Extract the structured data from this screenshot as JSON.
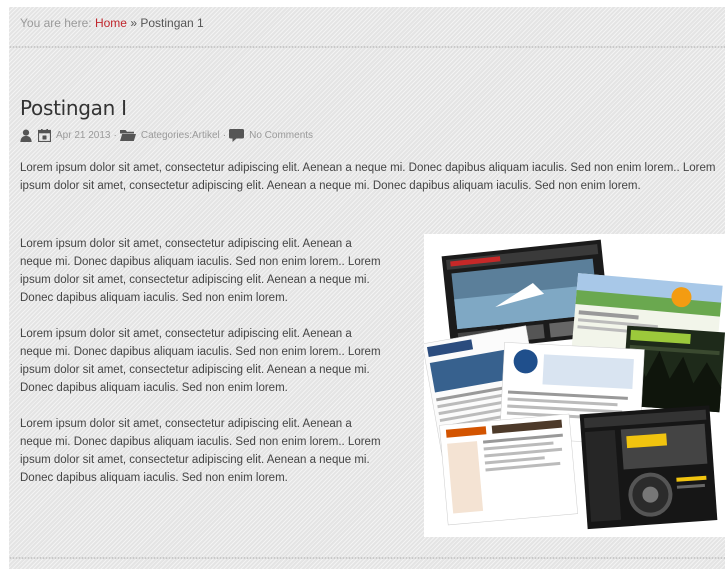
{
  "breadcrumb": {
    "prefix": "You are here: ",
    "home": "Home",
    "separator": "»",
    "current": "Postingan 1"
  },
  "post": {
    "title": "Postingan I",
    "meta": {
      "date": "Apr 21 2013",
      "sep1": "·",
      "categories_label": "Categories:",
      "category": "Artikel",
      "sep2": "·",
      "comments": "No Comments"
    },
    "paragraphs": [
      "Lorem ipsum dolor sit amet, consectetur adipiscing elit. Aenean a neque mi. Donec dapibus aliquam iaculis. Sed non enim lorem.. Lorem ipsum dolor sit amet, consectetur adipiscing elit. Aenean a neque mi. Donec dapibus aliquam iaculis. Sed non enim lorem.",
      "Lorem ipsum dolor sit amet, consectetur adipiscing elit. Aenean a neque mi. Donec dapibus aliquam iaculis. Sed non enim lorem.. Lorem ipsum dolor sit amet, consectetur adipiscing elit. Aenean a neque mi. Donec dapibus aliquam iaculis. Sed non enim lorem.",
      "Lorem ipsum dolor sit amet, consectetur adipiscing elit. Aenean a neque mi. Donec dapibus aliquam iaculis. Sed non enim lorem.. Lorem ipsum dolor sit amet, consectetur adipiscing elit. Aenean a neque mi. Donec dapibus aliquam iaculis. Sed non enim lorem.",
      "Lorem ipsum dolor sit amet, consectetur adipiscing elit. Aenean a neque mi. Donec dapibus aliquam iaculis. Sed non enim lorem.. Lorem ipsum dolor sit amet, consectetur adipiscing elit. Aenean a neque mi. Donec dapibus aliquam iaculis. Sed non enim lorem."
    ]
  },
  "icons": {
    "author": "user-icon",
    "date": "calendar-icon",
    "category": "folder-icon",
    "comments": "comment-icon"
  },
  "colors": {
    "link": "#c0272d",
    "background": "#e4e4e4",
    "text": "#444444",
    "meta": "#9a9a9a"
  }
}
